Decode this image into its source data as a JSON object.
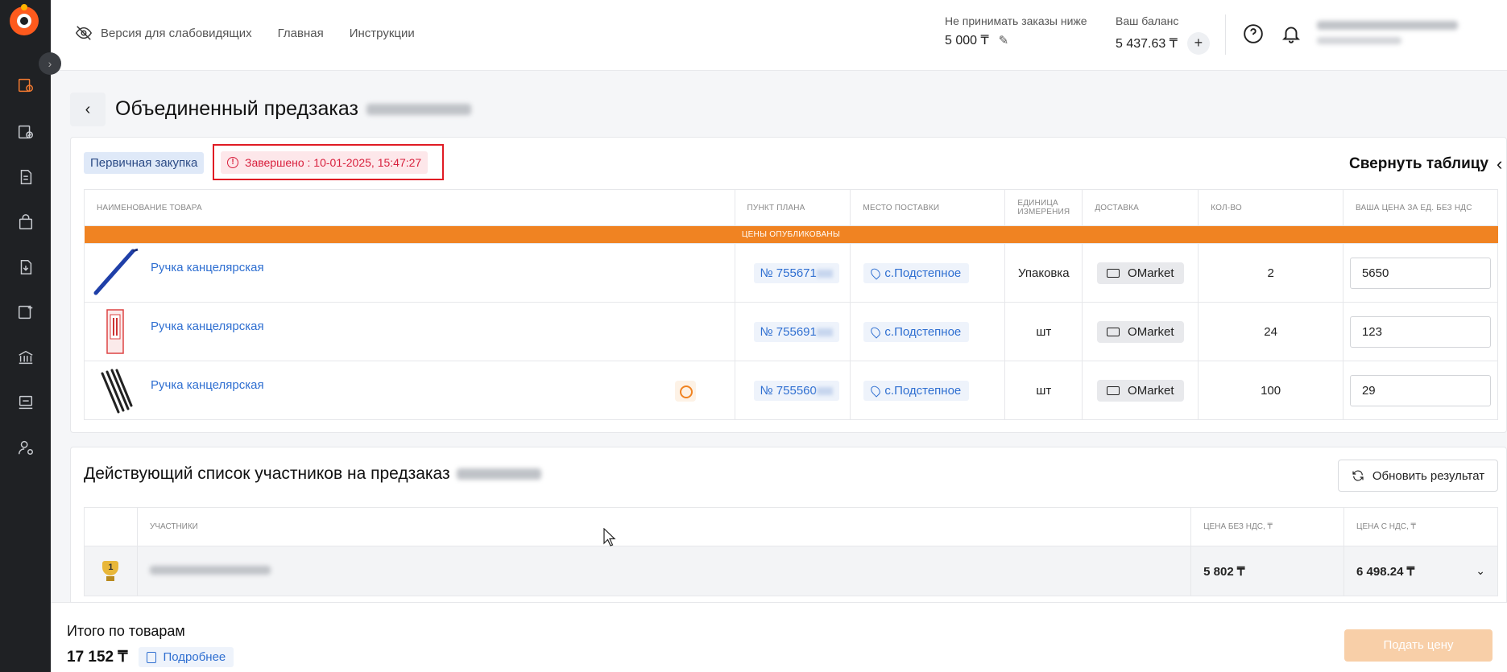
{
  "topbar": {
    "low_vision_label": "Версия для слабовидящих",
    "home_label": "Главная",
    "instructions_label": "Инструкции",
    "min_order_label": "Не принимать заказы ниже",
    "min_order_value": "5 000 ₸",
    "balance_label": "Ваш баланс",
    "balance_value": "5 437.63 ₸",
    "add_label": "+"
  },
  "page": {
    "title": "Объединенный предзаказ"
  },
  "order": {
    "type_badge": "Первичная закупка",
    "status": "Завершено : 10-01-2025, 15:47:27",
    "collapse_label": "Свернуть таблицу",
    "columns": [
      "Наименование товара",
      "Пункт плана",
      "Место поставки",
      "Единица измерения",
      "Доставка",
      "Кол-во",
      "Ваша цена за ед. без НДС"
    ],
    "published_banner": "Цены опубликованы",
    "rows": [
      {
        "name": "Ручка канцелярская",
        "plan": "№ 755671",
        "place": "с.Подстепное",
        "unit": "Упаковка",
        "delivery": "OMarket",
        "qty": "2",
        "price": "5650"
      },
      {
        "name": "Ручка канцелярская",
        "plan": "№ 755691",
        "place": "с.Подстепное",
        "unit": "шт",
        "delivery": "OMarket",
        "qty": "24",
        "price": "123"
      },
      {
        "name": "Ручка канцелярская",
        "plan": "№ 755560",
        "place": "с.Подстепное",
        "unit": "шт",
        "delivery": "OMarket",
        "qty": "100",
        "price": "29"
      }
    ]
  },
  "participants": {
    "title": "Действующий список участников на предзаказ",
    "refresh_label": "Обновить результат",
    "columns": [
      "Участники",
      "Цена без НДС, ₸",
      "Цена с НДС, ₸"
    ],
    "rows": [
      {
        "rank": "1",
        "price_no_vat": "5 802 ₸",
        "price_vat": "6 498.24 ₸"
      }
    ]
  },
  "footer": {
    "total_label": "Итого по товарам",
    "total_value": "17 152 ₸",
    "details_label": "Подробнее",
    "submit_label": "Подать цену"
  },
  "colors": {
    "accent": "#f08322",
    "link": "#2f6fd1",
    "status": "#d81f3c",
    "sidebar": "#1f2124"
  }
}
